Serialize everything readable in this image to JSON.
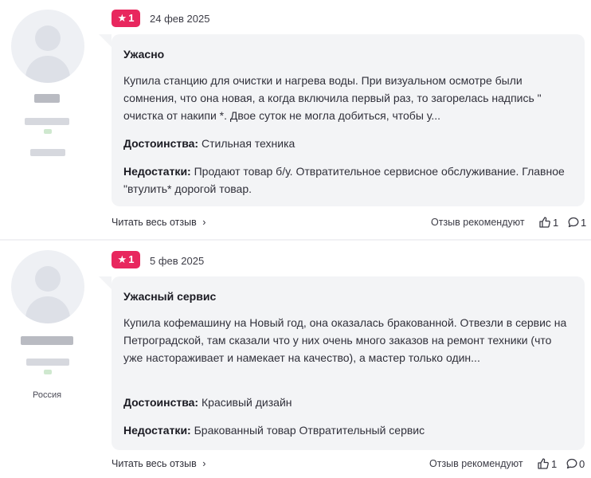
{
  "reviews": [
    {
      "rating": "1",
      "date": "24 фев 2025",
      "country": "",
      "title": "Ужасно",
      "text": "Купила станцию для очистки и нагрева воды. При визуальном осмотре были сомнения, что она новая, а когда включила первый раз, то загорелась надпись \" очистка от накипи *. Двое суток не могла добиться, чтобы у...",
      "pros_label": "Достоинства:",
      "pros": "Стильная техника",
      "cons_label": "Недостатки:",
      "cons": "Продают товар б/у. Отвратительное сервисное обслуживание. Главное \"втулить* дорогой товар.",
      "read_more": "Читать весь отзыв",
      "recommend": "Отзыв рекомендуют",
      "likes": "1",
      "comments": "1"
    },
    {
      "rating": "1",
      "date": "5 фев 2025",
      "country": "Россия",
      "title": "Ужасный сервис",
      "text": "Купила кофемашину на Новый год, она оказалась бракованной. Отвезли в сервис на Петроградской, там сказали что у них очень много заказов на ремонт техники (что уже настораживает и намекает на качество), а мастер только один...",
      "pros_label": "Достоинства:",
      "pros": "Красивый дизайн",
      "cons_label": "Недостатки:",
      "cons": "Бракованный товар Отвратительный сервис",
      "read_more": "Читать весь отзыв",
      "recommend": "Отзыв рекомендуют",
      "likes": "1",
      "comments": "0"
    }
  ],
  "icons": {
    "star": "star-icon",
    "chevron": "chevron-right-icon",
    "like": "thumbs-up-icon",
    "comment": "comment-icon"
  },
  "colors": {
    "badge": "#e8275e",
    "bubble": "#f3f4f6"
  }
}
